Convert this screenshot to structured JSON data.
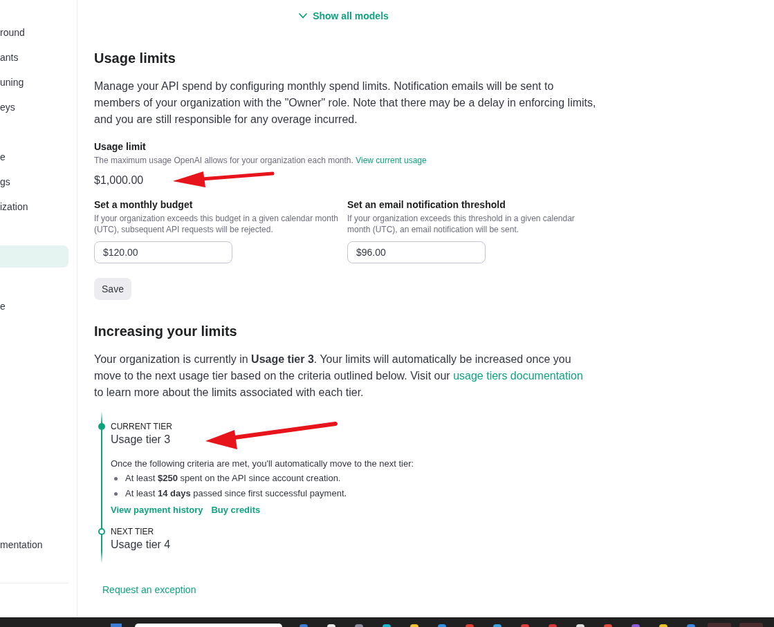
{
  "sidebar": {
    "groups": [
      {
        "items": [
          {
            "label": "round",
            "selected": false
          },
          {
            "label": "ants",
            "selected": false
          },
          {
            "label": "uning",
            "selected": false
          },
          {
            "label": "eys",
            "selected": false
          }
        ]
      },
      {
        "items": [
          {
            "label": "e",
            "selected": false
          },
          {
            "label": "gs",
            "selected": false
          },
          {
            "label": "ization",
            "selected": false
          }
        ]
      },
      {
        "items": [
          {
            "selected": true
          }
        ]
      },
      {
        "items": [
          {
            "label": "e",
            "selected": false
          }
        ]
      }
    ],
    "footer_item": "mentation"
  },
  "show_all_models": "Show all models",
  "usage_limits": {
    "title": "Usage limits",
    "description": "Manage your API spend by configuring monthly spend limits. Notification emails will be sent to members of your organization with the \"Owner\" role. Note that there may be a delay in enforcing limits, and you are still responsible for any overage incurred.",
    "limit": {
      "label": "Usage limit",
      "hint": "The maximum usage OpenAI allows for your organization each month.",
      "link": "View current usage",
      "value": "$1,000.00"
    },
    "fields": [
      {
        "label": "Set a monthly budget",
        "hint": "If your organization exceeds this budget in a given calendar month (UTC), subsequent API requests will be rejected.",
        "value": "$120.00"
      },
      {
        "label": "Set an email notification threshold",
        "hint": "If your organization exceeds this threshold in a given calendar month (UTC), an email notification will be sent.",
        "value": "$96.00"
      }
    ],
    "save_button": "Save"
  },
  "increasing_limits": {
    "title": "Increasing your limits",
    "text_before": "Your organization is currently in **Usage tier 3**. Your limits will automatically be increased once you move to the next usage tier based on the criteria outlined below. Visit our",
    "link": "usage tiers documentation",
    "text_after": "to learn more about the limits associated with each tier.",
    "tiers": [
      {
        "kind": "current",
        "caption": "CURRENT TIER",
        "name": "Usage tier 3",
        "criteria_intro": "Once the following criteria are met, you'll automatically move to the next tier:",
        "criteria": [
          "At least **$250** spent on the API since account creation.",
          "At least **14 days** passed since first successful payment."
        ],
        "links": [
          "View payment history",
          "Buy credits"
        ]
      },
      {
        "kind": "next",
        "caption": "NEXT TIER",
        "name": "Usage tier 4"
      }
    ],
    "exception_link": "Request an exception"
  }
}
